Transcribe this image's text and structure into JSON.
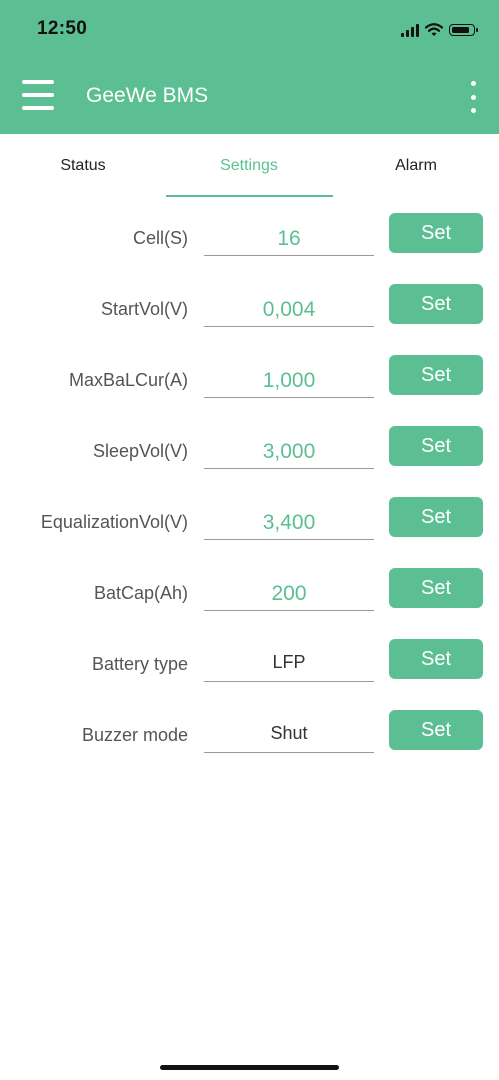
{
  "status_bar": {
    "time": "12:50"
  },
  "header": {
    "title": "GeeWe BMS"
  },
  "tabs": [
    {
      "label": "Status"
    },
    {
      "label": "Settings"
    },
    {
      "label": "Alarm"
    }
  ],
  "active_tab": "Settings",
  "settings": [
    {
      "label": "Cell(S)",
      "value": "16",
      "button": "Set"
    },
    {
      "label": "StartVol(V)",
      "value": "0,004",
      "button": "Set"
    },
    {
      "label": "MaxBaLCur(A)",
      "value": "1,000",
      "button": "Set"
    },
    {
      "label": "SleepVol(V)",
      "value": "3,000",
      "button": "Set"
    },
    {
      "label": "EqualizationVol(V)",
      "value": "3,400",
      "button": "Set"
    },
    {
      "label": "BatCap(Ah)",
      "value": "200",
      "button": "Set"
    },
    {
      "label": "Battery type",
      "value": "LFP",
      "button": "Set"
    },
    {
      "label": "Buzzer mode",
      "value": "Shut",
      "button": "Set"
    }
  ],
  "colors": {
    "accent": "#5cbf93",
    "label_text": "#555555"
  },
  "icons": [
    "menu-icon",
    "more-vert-icon",
    "signal-icon",
    "wifi-icon",
    "battery-icon"
  ]
}
